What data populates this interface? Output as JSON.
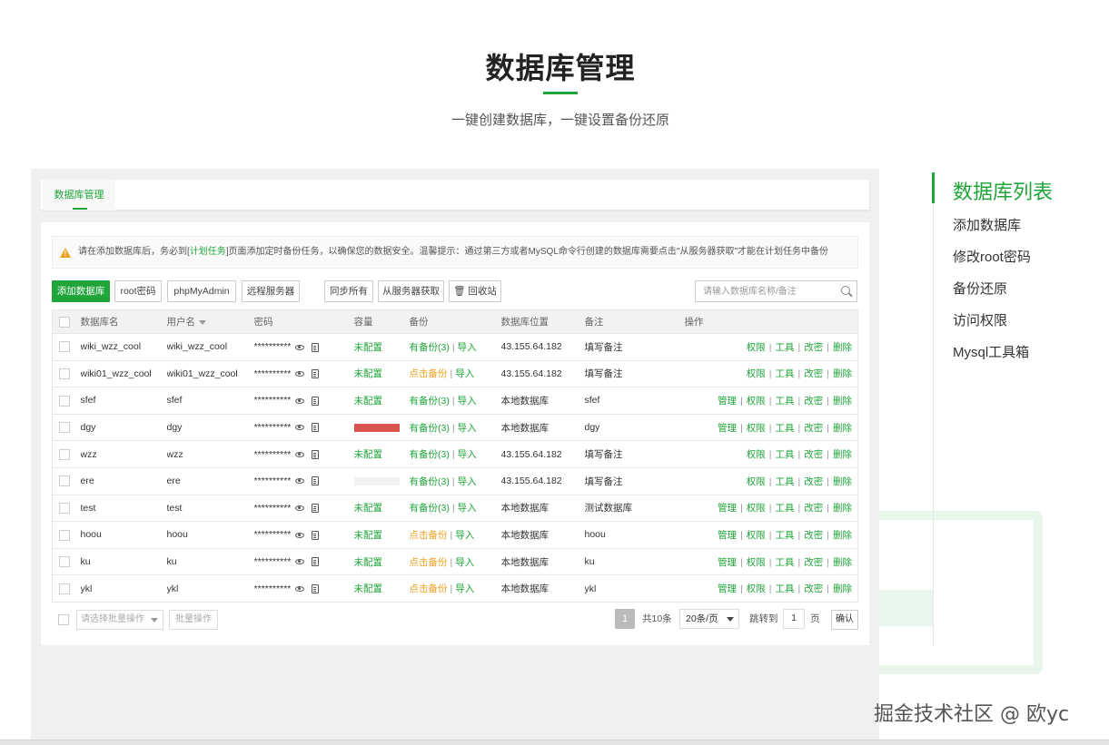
{
  "hero": {
    "title": "数据库管理",
    "subtitle": "一键创建数据库，一键设置备份还原"
  },
  "tab": {
    "label": "数据库管理"
  },
  "notice": {
    "pre": "请在添加数据库后，务必到[",
    "link": "计划任务",
    "post": "]页面添加定时备份任务，以确保您的数据安全。温馨提示：通过第三方或者MySQL命令行创建的数据库需要点击\"从服务器获取\"才能在计划任务中备份"
  },
  "toolbar": {
    "add_db": "添加数据库",
    "root_pwd": "root密码",
    "phpmyadmin": "phpMyAdmin",
    "remote_server": "远程服务器",
    "sync_all": "同步所有",
    "fetch_server": "从服务器获取",
    "recycle": "回收站",
    "search_placeholder": "请输入数据库名称/备注"
  },
  "table": {
    "headers": {
      "name": "数据库名",
      "user": "用户名",
      "password": "密码",
      "capacity": "容量",
      "backup": "备份",
      "location": "数据库位置",
      "note": "备注",
      "ops": "操作"
    },
    "rows": [
      {
        "name": "wiki_wzz_cool",
        "user": "wiki_wzz_cool",
        "password": "**********",
        "capacity": "未配置",
        "backup": "有备份(3)",
        "import": "导入",
        "location": "43.155.64.182",
        "note": "填写备注"
      },
      {
        "name": "wiki01_wzz_cool",
        "user": "wiki01_wzz_cool",
        "password": "**********",
        "capacity": "未配置",
        "backup": "点击备份",
        "import": "导入",
        "location": "43.155.64.182",
        "note": "填写备注"
      },
      {
        "name": "sfef",
        "user": "sfef",
        "password": "**********",
        "capacity": "未配置",
        "backup": "有备份(3)",
        "import": "导入",
        "location": "本地数据库",
        "note": "sfef"
      },
      {
        "name": "dgy",
        "user": "dgy",
        "password": "**********",
        "capacity": "",
        "backup": "有备份(3)",
        "import": "导入",
        "location": "本地数据库",
        "note": "dgy"
      },
      {
        "name": "wzz",
        "user": "wzz",
        "password": "**********",
        "capacity": "未配置",
        "backup": "有备份(3)",
        "import": "导入",
        "location": "43.155.64.182",
        "note": "填写备注"
      },
      {
        "name": "ere",
        "user": "ere",
        "password": "**********",
        "capacity": "",
        "backup": "有备份(3)",
        "import": "导入",
        "location": "43.155.64.182",
        "note": "填写备注"
      },
      {
        "name": "test",
        "user": "test",
        "password": "**********",
        "capacity": "未配置",
        "backup": "有备份(3)",
        "import": "导入",
        "location": "本地数据库",
        "note": "测试数据库"
      },
      {
        "name": "hoou",
        "user": "hoou",
        "password": "**********",
        "capacity": "未配置",
        "backup": "点击备份",
        "import": "导入",
        "location": "本地数据库",
        "note": "hoou"
      },
      {
        "name": "ku",
        "user": "ku",
        "password": "**********",
        "capacity": "未配置",
        "backup": "点击备份",
        "import": "导入",
        "location": "本地数据库",
        "note": "ku"
      },
      {
        "name": "ykl",
        "user": "ykl",
        "password": "**********",
        "capacity": "未配置",
        "backup": "点击备份",
        "import": "导入",
        "location": "本地数据库",
        "note": "ykl"
      }
    ],
    "op_manage": "管理",
    "op_perm": "权限",
    "op_tools": "工具",
    "op_chpwd": "改密",
    "op_delete": "删除"
  },
  "footer": {
    "batch_placeholder": "请选择批量操作",
    "batch_btn": "批量操作",
    "page": "1",
    "total": "共10条",
    "page_size": "20条/页",
    "jump_label": "跳转到",
    "jump_value": "1",
    "page_unit": "页",
    "confirm": "确认"
  },
  "sidebar": {
    "items": [
      {
        "label": "数据库列表"
      },
      {
        "label": "添加数据库"
      },
      {
        "label": "修改root密码"
      },
      {
        "label": "备份还原"
      },
      {
        "label": "访问权限"
      },
      {
        "label": "Mysql工具箱"
      }
    ]
  },
  "watermark": "掘金技术社区 @ 欧yc",
  "colors": {
    "accent": "#20a53a",
    "warn": "#f0a020",
    "danger": "#d9534f"
  }
}
